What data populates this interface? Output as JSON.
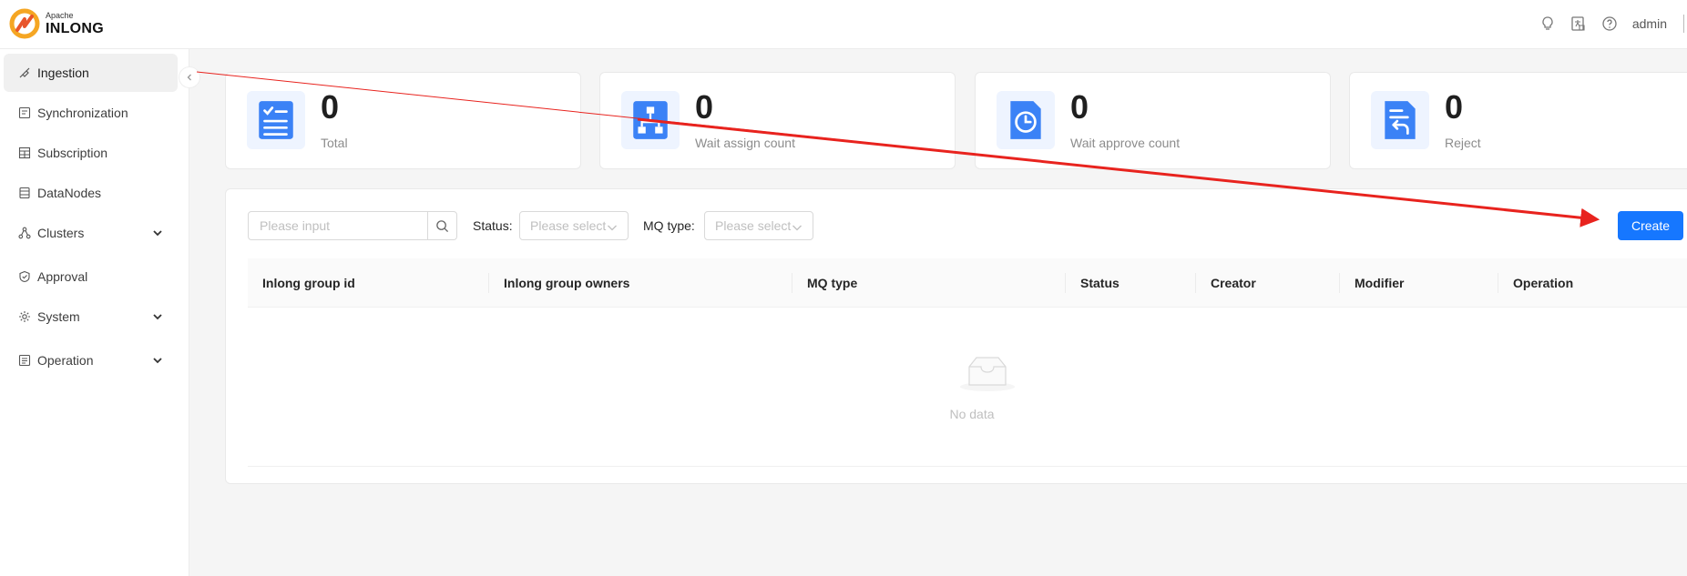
{
  "header": {
    "brand_small": "Apache",
    "brand_name": "INLONG",
    "user": "admin",
    "icons": [
      "bulb-icon",
      "language-icon",
      "help-icon"
    ]
  },
  "sidebar": {
    "items": [
      {
        "label": "Ingestion",
        "icon": "ingestion-icon",
        "active": true
      },
      {
        "label": "Synchronization",
        "icon": "sync-icon"
      },
      {
        "label": "Subscription",
        "icon": "subscription-icon"
      },
      {
        "label": "DataNodes",
        "icon": "datanodes-icon"
      },
      {
        "label": "Clusters",
        "icon": "clusters-icon",
        "expandable": true
      },
      {
        "label": "Approval",
        "icon": "approval-icon"
      },
      {
        "label": "System",
        "icon": "system-icon",
        "expandable": true
      },
      {
        "label": "Operation",
        "icon": "operation-icon",
        "expandable": true
      }
    ]
  },
  "stats": [
    {
      "value": "0",
      "label": "Total",
      "icon": "checklist-icon"
    },
    {
      "value": "0",
      "label": "Wait assign count",
      "icon": "hierarchy-icon"
    },
    {
      "value": "0",
      "label": "Wait approve count",
      "icon": "clock-doc-icon"
    },
    {
      "value": "0",
      "label": "Reject",
      "icon": "return-doc-icon"
    }
  ],
  "filters": {
    "search_placeholder": "Please input",
    "status_label": "Status:",
    "status_placeholder": "Please select",
    "mq_label": "MQ type:",
    "mq_placeholder": "Please select"
  },
  "actions": {
    "create_label": "Create"
  },
  "table": {
    "columns": [
      "Inlong group id",
      "Inlong group owners",
      "MQ type",
      "Status",
      "Creator",
      "Modifier",
      "Operation"
    ],
    "empty_text": "No data"
  },
  "colors": {
    "primary": "#1677ff",
    "icon_blue": "#3b82f6",
    "logo_orange": "#f5a623",
    "annotation_red": "#e8231e"
  }
}
